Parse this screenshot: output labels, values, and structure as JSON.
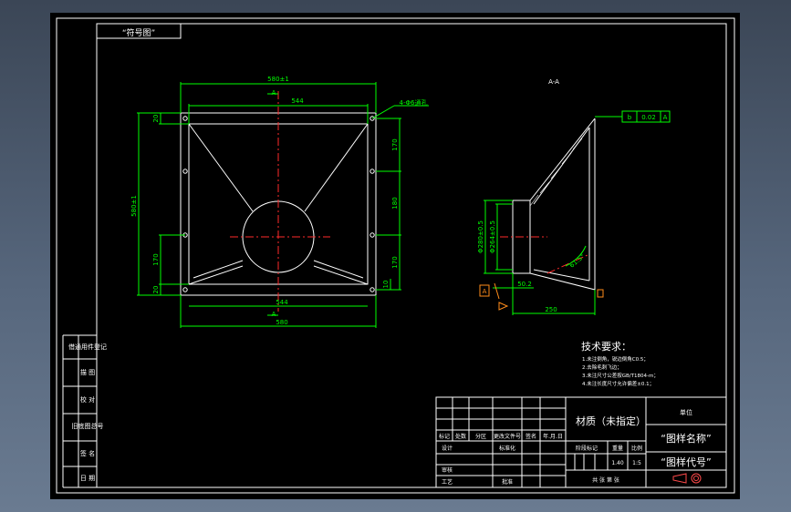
{
  "drawing": {
    "top_label": "“符号图”",
    "section_label": "A-A",
    "dims": {
      "top_overall": "580±1",
      "top_inner": "544",
      "bottom_inner": "544",
      "bottom_overall": "580",
      "hole_note": "4-Φ6通孔",
      "left_overall": "580±1",
      "left_top_margin": "20",
      "left_lower": "170",
      "left_bottom_margin": "20",
      "right_top": "170",
      "right_mid": "180",
      "right_lower": "170",
      "right_bottom": "10",
      "section_a_top": "A",
      "section_a_bottom": "A",
      "side_dia_outer": "Φ280±0.5",
      "side_dia_inner": "Φ264±0.5",
      "side_length_1": "50.2",
      "side_length_2": "250",
      "side_angle": "61.5°",
      "tol_symbol": "b",
      "tol_value": "0.02",
      "tol_datum": "A",
      "datum_label": "A"
    },
    "tech_req": {
      "title": "技术要求：",
      "items": [
        "1.未注倒角，锐边倒角C0.5；",
        "2.去除毛刺飞边；",
        "3.未注尺寸公差按GB/T1804-m；",
        "4.未注长度尺寸允许偏差±0.1；"
      ]
    },
    "left_strip": [
      "借通用件登记",
      "描 图",
      "校 对",
      "旧底图总号",
      "签 名",
      "日 期"
    ],
    "title_block": {
      "material": "材质（未指定）",
      "company": "单位",
      "drawing_name": "“图样名称”",
      "drawing_code": "“图样代号”",
      "rev_headers": [
        "标记",
        "处数",
        "分区",
        "更改文件号",
        "签名",
        "年.月.日"
      ],
      "design": "设计",
      "standardize": "标准化",
      "review": "审核",
      "process": "工艺",
      "approve": "批准",
      "stage_mark": "阶段标记",
      "weight": "重量",
      "scale": "比例",
      "weight_value": "1.40",
      "scale_value": "1:5",
      "sheets": "共   张  第   张"
    }
  }
}
